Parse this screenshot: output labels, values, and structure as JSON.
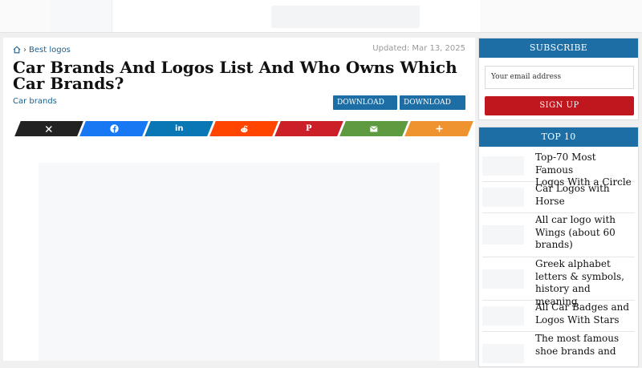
{
  "breadcrumb": {
    "home_icon": "home-icon",
    "separator": "›",
    "link": "Best logos"
  },
  "updated": "Updated: Mar 13, 2025",
  "title": "Car Brands And Logos List And Who Owns Which Car Brands?",
  "category": "Car brands",
  "download": {
    "svg": "DOWNLOAD SVG",
    "png": "DOWNLOAD PNG"
  },
  "share": [
    {
      "name": "x",
      "icon": "x-icon",
      "color": "#222222"
    },
    {
      "name": "facebook",
      "icon": "facebook-icon",
      "color": "#1877f2"
    },
    {
      "name": "linkedin",
      "icon": "linkedin-icon",
      "color": "#0a77b5"
    },
    {
      "name": "reddit",
      "icon": "reddit-icon",
      "color": "#ff4500"
    },
    {
      "name": "pinterest",
      "icon": "pinterest-icon",
      "color": "#cb2027"
    },
    {
      "name": "email",
      "icon": "mail-icon",
      "color": "#5e9a3f"
    },
    {
      "name": "more",
      "icon": "plus-icon",
      "color": "#ef9230"
    }
  ],
  "subscribe": {
    "heading": "SUBSCRIBE",
    "email_value": "Your email address",
    "button": "SIGN UP"
  },
  "top10": {
    "heading": "TOP 10",
    "items": [
      {
        "l1": "Top-70 Most Famous",
        "l2": "Logos With a Circle",
        "l3": ""
      },
      {
        "l1": "Car Logos with",
        "l2": "Horse",
        "l3": ""
      },
      {
        "l1": "All car logo with",
        "l2": "Wings (about 60",
        "l3": "brands)"
      },
      {
        "l1": "Greek alphabet",
        "l2": "letters & symbols,",
        "l3": "history and meaning"
      },
      {
        "l1": "All Car Badges and",
        "l2": "Logos With Stars",
        "l3": ""
      },
      {
        "l1": "The most famous",
        "l2": "shoe brands and",
        "l3": ""
      }
    ]
  },
  "colors": {
    "accent": "#1e6ea6",
    "signup": "#c0161d",
    "link": "#1a5f8f"
  }
}
